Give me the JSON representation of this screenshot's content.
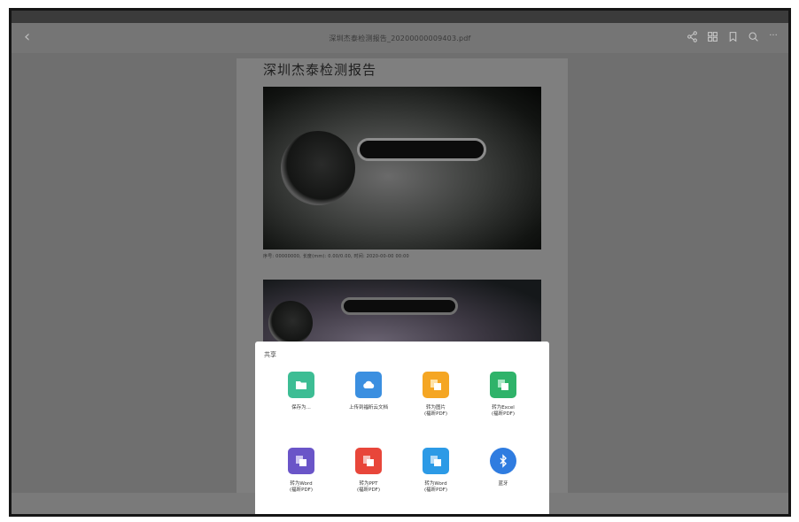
{
  "toolbar": {
    "title": "深圳杰泰检测报告_20200000009403.pdf",
    "icons": [
      "back-icon",
      "share-icon",
      "grid-icon",
      "bookmark-icon",
      "search-icon",
      "more-icon"
    ],
    "more_glyph": "···"
  },
  "document": {
    "heading": "深圳杰泰检测报告",
    "caption": "序号: 00000000, 长度(mm): 0.00/0.00, 时间: 2020-00-00 00:00"
  },
  "share_sheet": {
    "title": "共享",
    "items": [
      {
        "label": "保存为...",
        "icon": "folder-icon",
        "color": "#3dbd94"
      },
      {
        "label": "上传到福昕云文档",
        "icon": "cloud-upload-icon",
        "color": "#3b8fe0"
      },
      {
        "label": "转为图片\n(福昕PDF)",
        "icon": "convert-image-icon",
        "color": "#f5a623"
      },
      {
        "label": "转为Excel\n(福昕PDF)",
        "icon": "convert-excel-icon",
        "color": "#2fb36a"
      },
      {
        "label": "转为Word\n(福昕PDF)",
        "icon": "convert-word-icon",
        "color": "#6a55c8"
      },
      {
        "label": "转为PPT\n(福昕PDF)",
        "icon": "convert-ppt-icon",
        "color": "#e8463a"
      },
      {
        "label": "转为Word\n(福昕PDF)",
        "icon": "convert-word-icon",
        "color": "#2c9ae6"
      },
      {
        "label": "蓝牙",
        "icon": "bluetooth-icon",
        "color": "#2f7ce0"
      }
    ]
  }
}
